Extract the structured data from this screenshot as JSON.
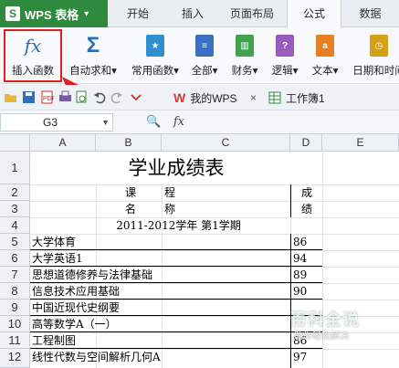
{
  "app": {
    "name": "WPS 表格",
    "logo_letter": "S"
  },
  "tabs": [
    "开始",
    "插入",
    "页面布局",
    "公式",
    "数据"
  ],
  "ribbon": {
    "buttons": [
      {
        "label": "插入函数",
        "icon": "fx-icon"
      },
      {
        "label": "自动求和",
        "icon": "sigma-icon"
      },
      {
        "label": "常用函数",
        "icon": "star-book-icon"
      },
      {
        "label": "全部",
        "icon": "list-book-icon"
      },
      {
        "label": "财务",
        "icon": "finance-book-icon"
      },
      {
        "label": "逻辑",
        "icon": "question-book-icon"
      },
      {
        "label": "文本",
        "icon": "text-a-book-icon"
      },
      {
        "label": "日期和时间",
        "icon": "clock-book-icon"
      }
    ],
    "fx_glyph": "fx",
    "sigma_glyph": "Σ"
  },
  "doc_tabs": {
    "wps_label": "我的WPS",
    "close": "×",
    "workbook_label": "工作簿1"
  },
  "formula_bar": {
    "cell_ref": "G3",
    "fx_label": "fx"
  },
  "columns": [
    "A",
    "B",
    "C",
    "D",
    "E"
  ],
  "rows": [
    "1",
    "2",
    "3",
    "4",
    "5",
    "6",
    "7",
    "8",
    "9",
    "10",
    "11",
    "12"
  ],
  "sheet": {
    "title": "学业成绩表",
    "h_ke": "课",
    "h_cheng": "程",
    "h_ming": "名",
    "h_cheng2": "称",
    "h_score1": "成",
    "h_score2": "绩",
    "term": "2011-2012学年  第1学期",
    "courses": [
      {
        "name": "大学体育",
        "score": "86"
      },
      {
        "name": "大学英语1",
        "score": "94"
      },
      {
        "name": "思想道德修养与法律基础",
        "score": "89"
      },
      {
        "name": "信息技术应用基础",
        "score": "90"
      },
      {
        "name": "中国近现代史纲要",
        "score": ""
      },
      {
        "name": "高等数学A（一）",
        "score": ""
      },
      {
        "name": "工程制图",
        "score": "86"
      },
      {
        "name": "线性代数与空间解析几何A",
        "score": "97"
      }
    ]
  },
  "watermark": {
    "title": "百科全说",
    "subtitle": "助你轻松解决"
  },
  "colors": {
    "brand_green": "#2e8b3d",
    "highlight_red": "#e02020"
  }
}
